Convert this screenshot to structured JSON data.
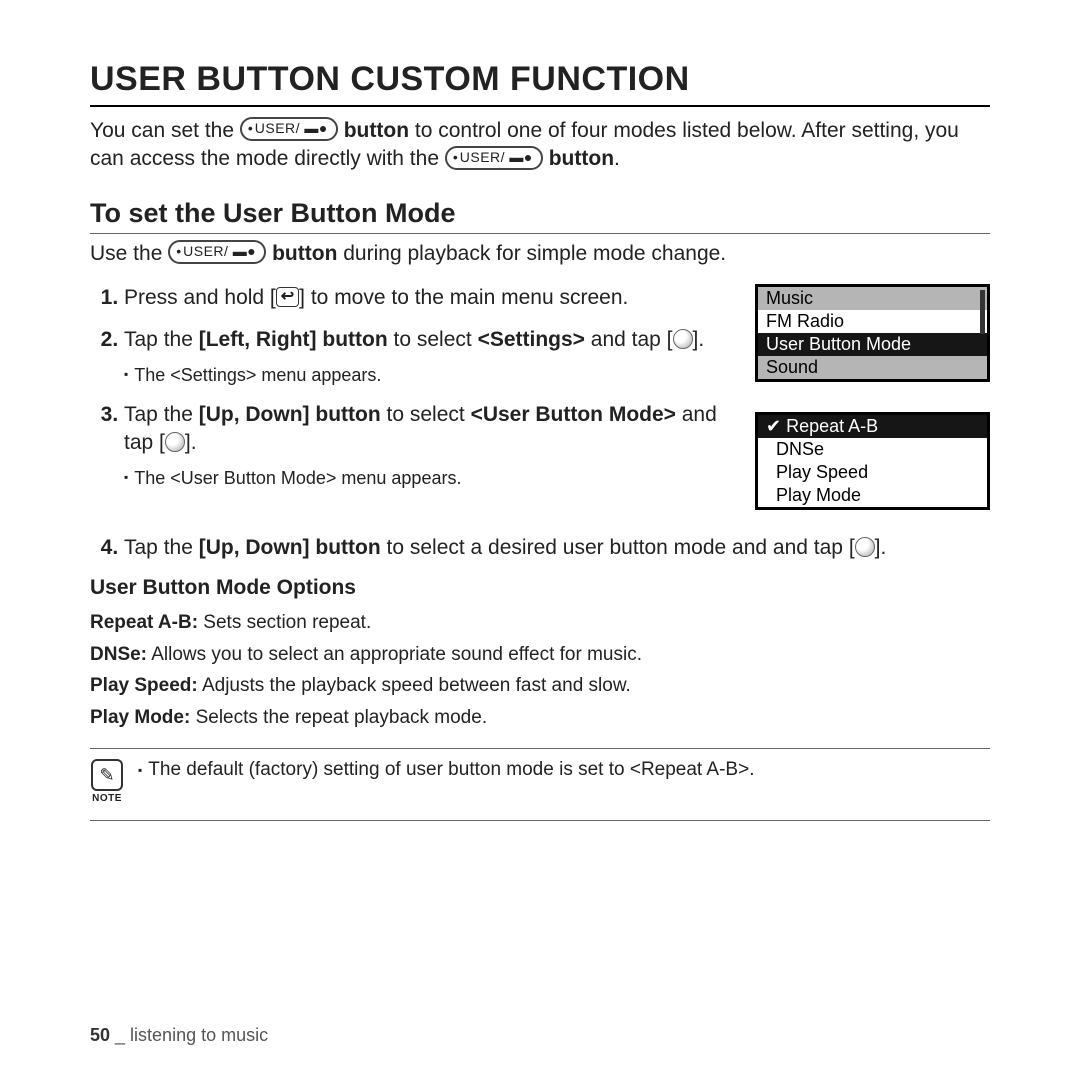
{
  "title": "USER BUTTON CUSTOM FUNCTION",
  "intro_1a": "You can set the ",
  "intro_1b": " button",
  "intro_1c": " to control one of four modes listed below. After setting, you can access the mode directly with the ",
  "intro_1d": " button",
  "intro_1e": ".",
  "user_pill": "USER/ ▬●",
  "h2": "To set the User Button Mode",
  "sub_a": "Use the ",
  "sub_b": " button",
  "sub_c": " during playback for simple mode change.",
  "steps": {
    "s1a": "Press and hold [",
    "s1b": "] to move to the main menu screen.",
    "back_icon": "↩",
    "s2a": "Tap the ",
    "s2b": "Left, Right] button",
    "s2c": " to select ",
    "s2d": "<Settings>",
    "s2e": " and tap [",
    "s2f": "].",
    "s2sub": "The <Settings> menu appears.",
    "s3a": "Tap the ",
    "s3b": "[Up, Down] button",
    "s3c": " to select ",
    "s3d": "<User Button Mode>",
    "s3e": " and tap [",
    "s3f": "].",
    "s3sub": "The <User Button Mode> menu appears.",
    "s4a": "Tap the ",
    "s4b": "[Up, Down] button",
    "s4c": " to select a desired user button mode and and tap [",
    "s4d": "]."
  },
  "screen1": {
    "r1": "Music",
    "r2": "FM Radio",
    "r3": "User Button Mode",
    "r4": "Sound"
  },
  "screen2": {
    "r1": "Repeat A-B",
    "check": "✔",
    "r2": "DNSe",
    "r3": "Play Speed",
    "r4": "Play Mode"
  },
  "opts_title": "User Button Mode Options",
  "opts": {
    "o1b": "Repeat A-B:",
    "o1": " Sets section repeat.",
    "o2b": "DNSe:",
    "o2": " Allows you to select an appropriate sound effect for music.",
    "o3b": "Play Speed:",
    "o3": " Adjusts the playback speed between fast and slow.",
    "o4b": "Play Mode:",
    "o4": " Selects the repeat playback mode."
  },
  "note_label": "NOTE",
  "note_glyph": "✎",
  "note_text": "The default (factory) setting of user button mode is set to <Repeat A-B>.",
  "footer_page": "50",
  "footer_sep": " _ ",
  "footer_text": "listening to music"
}
